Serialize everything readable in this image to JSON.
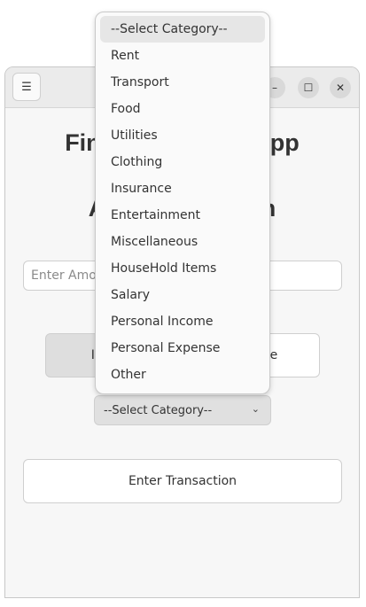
{
  "window": {
    "title_line1": "Finance Tracker App",
    "title_line2": "Add Transaction",
    "menu_icon": "hamburger-icon",
    "controls": {
      "minimize": "–",
      "maximize": "☐",
      "close": "✕"
    }
  },
  "form": {
    "amount_placeholder": "Enter Amount",
    "income_label": "Income",
    "expense_label": "Expense",
    "category_selected": "--Select Category--",
    "submit_label": "Enter Transaction"
  },
  "dropdown": {
    "items": [
      "--Select Category--",
      "Rent",
      "Transport",
      "Food",
      "Utilities",
      "Clothing",
      "Insurance",
      "Entertainment",
      "Miscellaneous",
      "HouseHold Items",
      "Salary",
      "Personal Income",
      "Personal Expense",
      "Other"
    ]
  }
}
